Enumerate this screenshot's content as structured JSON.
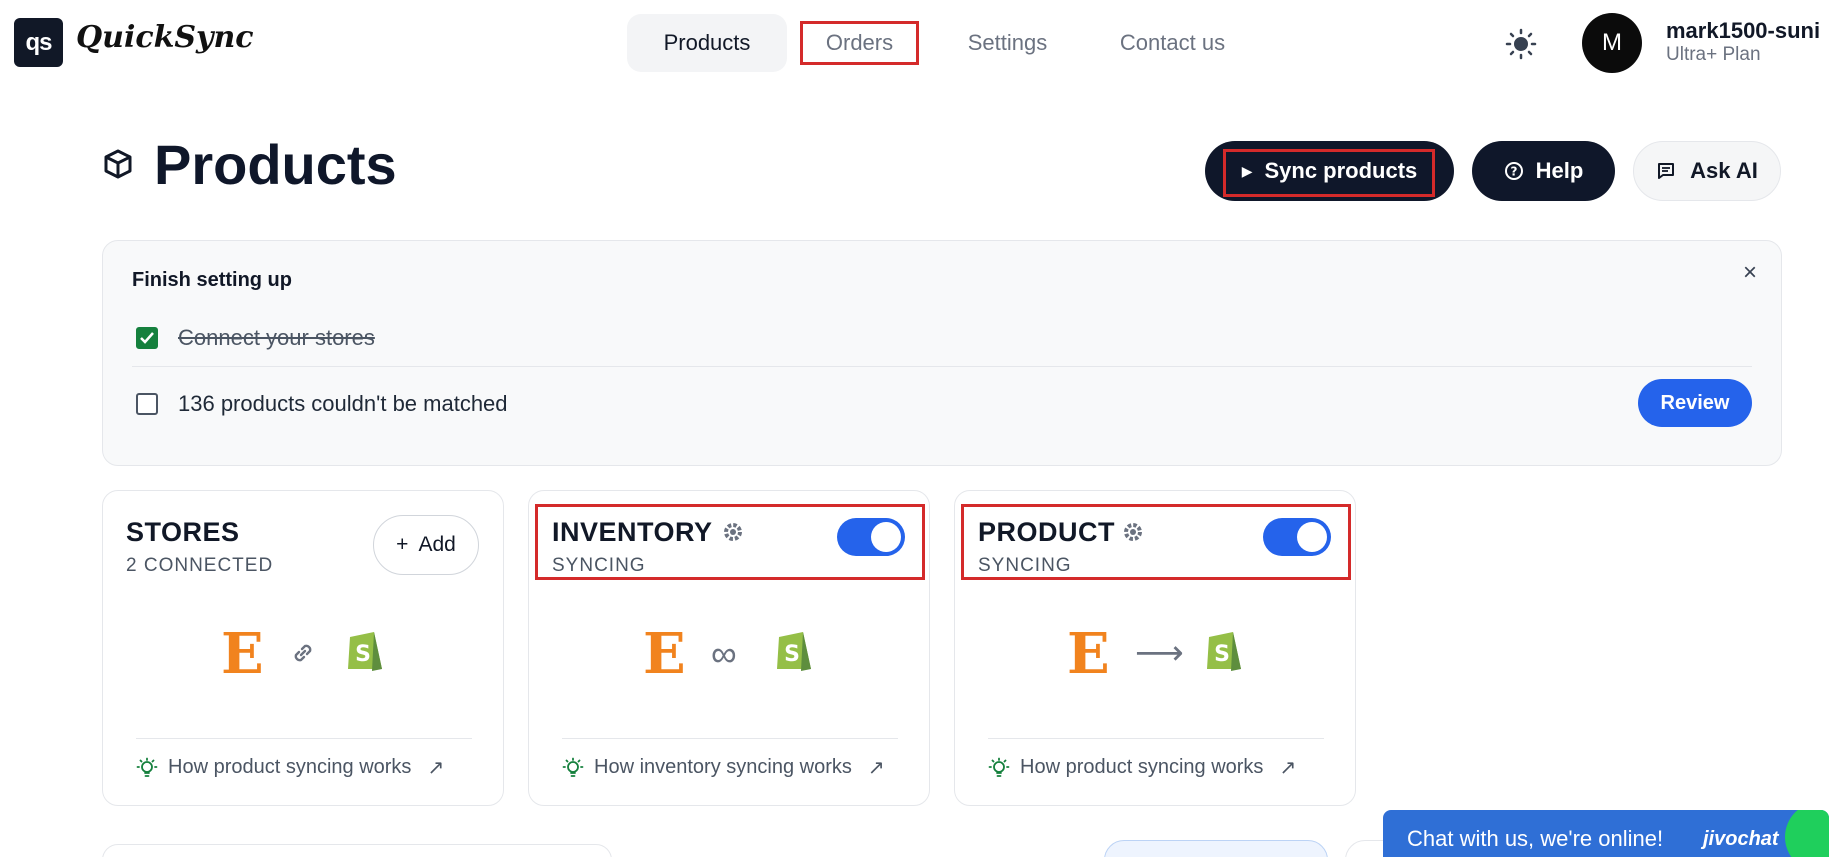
{
  "header": {
    "logo_mark": "qs",
    "logo_text": "QuickSync",
    "nav": [
      "Products",
      "Orders",
      "Settings",
      "Contact us"
    ],
    "user": {
      "initial": "M",
      "name": "mark1500-suni",
      "plan": "Ultra+ Plan"
    }
  },
  "page": {
    "title": "Products",
    "sync_button": "Sync products",
    "help_button": "Help",
    "ask_ai_button": "Ask AI"
  },
  "setup": {
    "title": "Finish setting up",
    "close": "×",
    "tasks": [
      {
        "label": "Connect your stores",
        "done": true
      },
      {
        "label": "136 products couldn't be matched",
        "done": false
      }
    ],
    "review_button": "Review"
  },
  "cards": [
    {
      "title": "STORES",
      "subtitle": "2 CONNECTED",
      "action": "Add",
      "link": "How product syncing works"
    },
    {
      "title": "INVENTORY",
      "subtitle": "SYNCING",
      "toggle_on": true,
      "link": "How inventory syncing works"
    },
    {
      "title": "PRODUCT",
      "subtitle": "SYNCING",
      "toggle_on": true,
      "link": "How product syncing works"
    }
  ],
  "etsy_letter": "E",
  "chat": {
    "text": "Chat with us, we're online!",
    "brand": "jivochat"
  },
  "colors": {
    "primary": "#2563eb",
    "dark": "#0f172a",
    "highlight": "#d42a2a",
    "etsy": "#f1831e",
    "shopify": "#95bf47"
  }
}
